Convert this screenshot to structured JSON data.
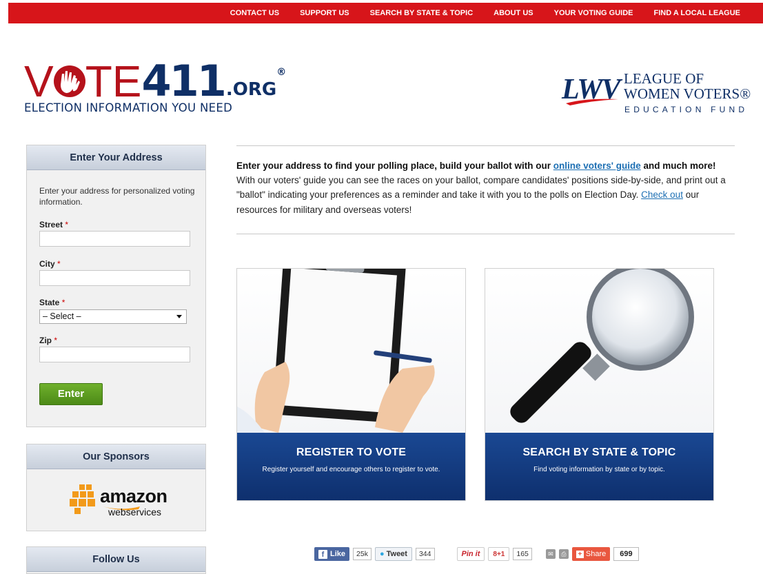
{
  "topnav": {
    "items": [
      "CONTACT US",
      "SUPPORT US",
      "SEARCH BY STATE & TOPIC",
      "ABOUT US",
      "YOUR VOTING GUIDE",
      "FIND A LOCAL LEAGUE"
    ]
  },
  "logo": {
    "v": "V",
    "te": "TE",
    "num": "411",
    "org": ".ORG",
    "reg": "®",
    "tagline": "ELECTION INFORMATION YOU NEED"
  },
  "lwv": {
    "mark": "LWV",
    "line1": "LEAGUE OF",
    "line2": "WOMEN VOTERS®",
    "line3": "EDUCATION FUND"
  },
  "address_box": {
    "title": "Enter Your Address",
    "intro": "Enter your address for personalized voting information.",
    "street_label": "Street",
    "city_label": "City",
    "state_label": "State",
    "zip_label": "Zip",
    "required": "*",
    "state_select": "– Select –",
    "enter_label": "Enter"
  },
  "sponsors": {
    "title": "Our Sponsors",
    "amazon_word": "amazon",
    "amazon_sub": "webservices"
  },
  "follow": {
    "title": "Follow Us"
  },
  "intro": {
    "bold1": "Enter your address to find your polling place, build your ballot with our ",
    "link1": "online voters' guide",
    "bold2": " and much more!",
    "text1": " With our voters' guide you can see the races on your ballot, compare candidates' positions side-by-side, and print out a \"ballot\" indicating your preferences as a reminder and take it with you to the polls on Election Day. ",
    "link2": "Check out",
    "text2": " our resources for military and overseas voters!"
  },
  "cards": [
    {
      "title": "REGISTER TO VOTE",
      "text": "Register yourself and encourage others to register to vote."
    },
    {
      "title": "SEARCH BY STATE & TOPIC",
      "text": "Find voting information by state or by topic."
    }
  ],
  "social": {
    "like": "Like",
    "like_count": "25k",
    "tweet": "Tweet",
    "tweet_count": "344",
    "pin": "Pin it",
    "gplus": "8+1",
    "gplus_count": "165",
    "share": "Share",
    "share_count": "699"
  },
  "colors": {
    "brand_red": "#d7151a",
    "navy": "#0f2f66",
    "button_green": "#5a9b20",
    "link_blue": "#1d6fb3"
  }
}
